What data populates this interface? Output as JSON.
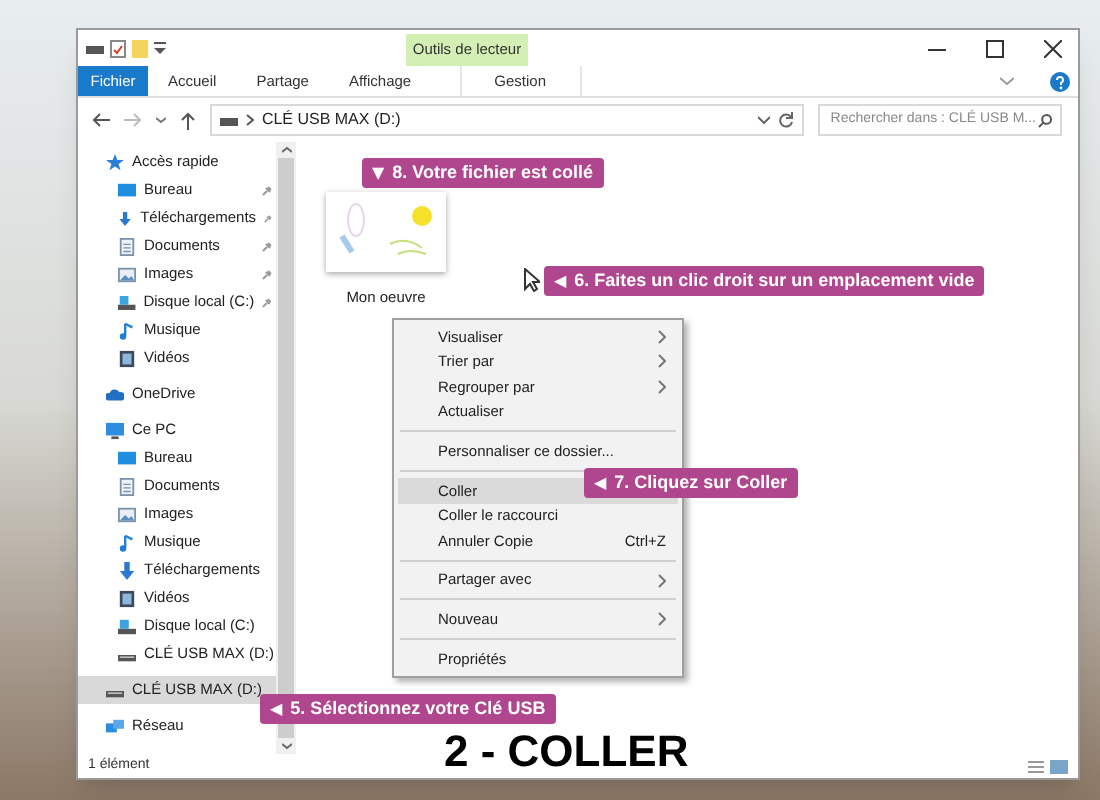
{
  "window": {
    "contextual_group": {
      "label": "Outils de lecteur"
    }
  },
  "ribbon_tabs": [
    {
      "label": "Fichier",
      "kind": "file",
      "selected": false
    },
    {
      "label": "Accueil",
      "kind": "tab",
      "selected": false
    },
    {
      "label": "Partage",
      "kind": "tab",
      "selected": false
    },
    {
      "label": "Affichage",
      "kind": "tab",
      "selected": false
    },
    {
      "label": "Gestion",
      "kind": "contextual",
      "selected": false
    }
  ],
  "address_bar": {
    "path": "CLÉ USB MAX (D:)"
  },
  "search": {
    "placeholder": "Rechercher dans : CLÉ USB M..."
  },
  "sidebar": {
    "items": [
      {
        "label": "Accès rapide",
        "kind": "star",
        "selected": false,
        "children": [
          {
            "label": "Bureau",
            "kind": "desktop",
            "selected": false,
            "pinned": true
          },
          {
            "label": "Téléchargements",
            "kind": "download",
            "selected": false,
            "pinned": true
          },
          {
            "label": "Documents",
            "kind": "documents",
            "selected": false,
            "pinned": true
          },
          {
            "label": "Images",
            "kind": "pictures",
            "selected": false,
            "pinned": true
          },
          {
            "label": "Disque local (C:)",
            "kind": "drive",
            "selected": false,
            "pinned": true
          },
          {
            "label": "Musique",
            "kind": "music",
            "selected": false,
            "pinned": false
          },
          {
            "label": "Vidéos",
            "kind": "videos",
            "selected": false,
            "pinned": false
          }
        ]
      },
      {
        "label": "OneDrive",
        "kind": "cloud",
        "selected": false
      },
      {
        "label": "Ce PC",
        "kind": "pc",
        "selected": false,
        "children": [
          {
            "label": "Bureau",
            "kind": "desktop",
            "selected": false
          },
          {
            "label": "Documents",
            "kind": "documents",
            "selected": false
          },
          {
            "label": "Images",
            "kind": "pictures",
            "selected": false
          },
          {
            "label": "Musique",
            "kind": "music",
            "selected": false
          },
          {
            "label": "Téléchargements",
            "kind": "download",
            "selected": false
          },
          {
            "label": "Vidéos",
            "kind": "videos",
            "selected": false
          },
          {
            "label": "Disque local (C:)",
            "kind": "drive",
            "selected": false
          },
          {
            "label": "CLÉ USB MAX (D:)",
            "kind": "usb",
            "selected": false
          }
        ]
      },
      {
        "label": "CLÉ USB MAX (D:)",
        "kind": "usb",
        "selected": true
      },
      {
        "label": "Réseau",
        "kind": "network",
        "selected": false
      }
    ]
  },
  "files": [
    {
      "name": "Mon oeuvre"
    }
  ],
  "context_menu": {
    "groups": [
      [
        {
          "label": "Visualiser",
          "submenu": true,
          "selected": false
        },
        {
          "label": "Trier par",
          "submenu": true,
          "selected": false
        },
        {
          "label": "Regrouper par",
          "submenu": true,
          "selected": false
        },
        {
          "label": "Actualiser",
          "submenu": false,
          "selected": false
        }
      ],
      [
        {
          "label": "Personnaliser ce dossier...",
          "submenu": false,
          "selected": false
        }
      ],
      [
        {
          "label": "Coller",
          "submenu": false,
          "selected": true
        },
        {
          "label": "Coller le raccourci",
          "submenu": false,
          "selected": false
        },
        {
          "label": "Annuler Copie",
          "shortcut": "Ctrl+Z",
          "submenu": false,
          "selected": false
        }
      ],
      [
        {
          "label": "Partager avec",
          "submenu": true,
          "selected": false
        }
      ],
      [
        {
          "label": "Nouveau",
          "submenu": true,
          "selected": false
        }
      ],
      [
        {
          "label": "Propriétés",
          "submenu": false,
          "selected": false
        }
      ]
    ]
  },
  "callouts": [
    {
      "text": "8. Votre fichier est collé",
      "marker": "▼"
    },
    {
      "text": "6. Faites un clic droit sur un emplacement vide",
      "marker": "◀"
    },
    {
      "text": "7. Cliquez sur Coller",
      "marker": "◀"
    },
    {
      "text": "5. Sélectionnez votre Clé USB",
      "marker": "◀"
    }
  ],
  "caption": "2 - COLLER",
  "status_bar": {
    "text": "1 élément"
  }
}
